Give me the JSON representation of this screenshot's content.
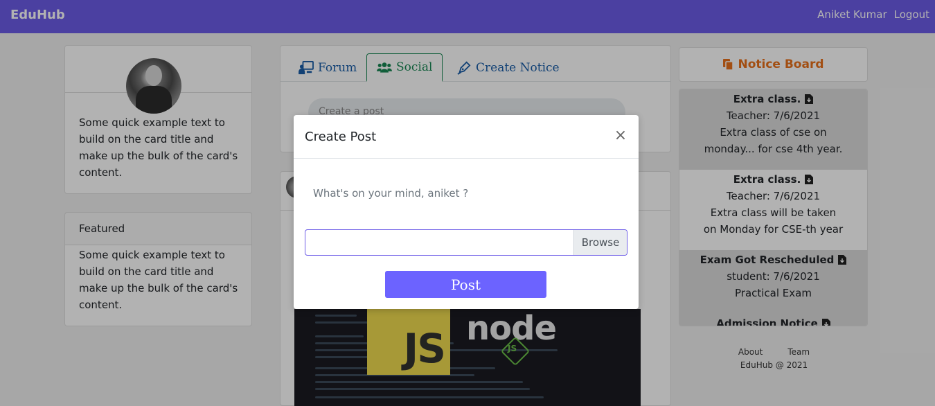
{
  "navbar": {
    "brand": "EduHub",
    "user_name": "Aniket Kumar",
    "logout_label": "Logout"
  },
  "profile_card": {
    "text": "Some quick example text to build on the card title and make up the bulk of the card's content."
  },
  "featured_card": {
    "header": "Featured",
    "text": "Some quick example text to build on the card title and make up the bulk of the card's content."
  },
  "tabs": [
    {
      "label": "Forum",
      "icon": "chalkboard-teacher-icon",
      "active": false
    },
    {
      "label": "Social",
      "icon": "users-icon",
      "active": true
    },
    {
      "label": "Create Notice",
      "icon": "pen-icon",
      "active": false
    }
  ],
  "create_post_placeholder": "Create a post",
  "post_image": {
    "js_text": "JS",
    "node_text": "node",
    "node_js_text": "JS"
  },
  "notice_board": {
    "title": "Notice Board",
    "items": [
      {
        "title": "Extra class.",
        "author_date": "Teacher: 7/6/2021",
        "body": "Extra class of cse on monday... for cse 4th year."
      },
      {
        "title": "Extra class.",
        "author_date": "Teacher: 7/6/2021",
        "body": "Extra class will be taken on Monday for CSE-th year"
      },
      {
        "title": "Exam Got Rescheduled",
        "author_date": "student: 7/6/2021",
        "body": "Practical Exam"
      },
      {
        "title": "Admission Notice",
        "author_date": "",
        "body": ""
      }
    ]
  },
  "footer": {
    "about": "About",
    "team": "Team",
    "copyright": "EduHub @ 2021"
  },
  "modal": {
    "title": "Create Post",
    "close_symbol": "×",
    "prompt": "What's on your mind, aniket ?",
    "browse_label": "Browse",
    "post_label": "Post"
  },
  "colors": {
    "navbar": "#6c5ce7",
    "post_button": "#6c63ff",
    "active_tab": "#198754",
    "tab_link": "#1a5ea8",
    "notice_title": "#e8701a"
  }
}
